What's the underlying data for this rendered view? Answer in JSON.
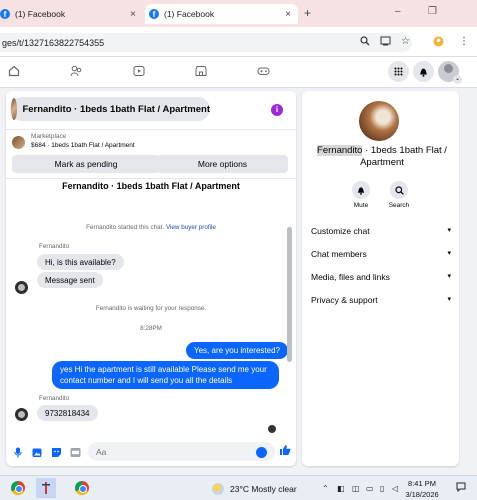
{
  "browser": {
    "tabs": [
      {
        "title": "(1) Facebook",
        "close": "×"
      },
      {
        "title": "(1) Facebook",
        "close": "×"
      }
    ],
    "new_tab": "+",
    "url": "ges/t/1327163822754355",
    "window_controls": [
      "–",
      "❐"
    ]
  },
  "nav": {
    "icons": [
      "home-icon",
      "friends-icon",
      "video-icon",
      "marketplace-icon",
      "gaming-icon"
    ],
    "right_icons": [
      "menu-grid-icon",
      "notifications-icon",
      "account-icon"
    ]
  },
  "chat": {
    "header_name": "Fernandito · 1beds 1bath Flat / Apartment",
    "marketplace": {
      "label": "Marketplace",
      "listing": "$684 · 1beds 1bath Flat / Apartment",
      "mark_pending": "Mark as pending",
      "more_options": "More options"
    },
    "thread_title": "Fernandito · 1beds 1bath Flat / Apartment",
    "system_started": "Fernandito started this chat.",
    "view_buyer": "View buyer profile",
    "sender1": "Fernandito",
    "msg_in_1": "Hi, is this available?",
    "msg_in_2": "Message sent",
    "system_waiting": "Fernandito is waiting for your response.",
    "time": "8:28PM",
    "msg_out_1": "Yes, are you interested?",
    "msg_out_2": "yes Hi the apartment is still available Please send me your contact number and I will send you all the details",
    "sender2": "Fernandito",
    "msg_in_3": "9732818434",
    "input_placeholder": "Aa"
  },
  "info": {
    "name_first": "Fernandito",
    "name_rest": " · 1beds 1bath Flat / Apartment",
    "actions": [
      {
        "label": "Mute"
      },
      {
        "label": "Search"
      }
    ],
    "sections": [
      "Customize chat",
      "Chat members",
      "Media, files and links",
      "Privacy & support"
    ]
  },
  "taskbar": {
    "weather": "23°C  Mostly clear",
    "time": "8:41 PM",
    "date": "3/18/2026"
  },
  "colors": {
    "messenger_blue": "#0a66ff",
    "fb_blue": "#1877f2",
    "info_purple": "#9b2bd8"
  }
}
